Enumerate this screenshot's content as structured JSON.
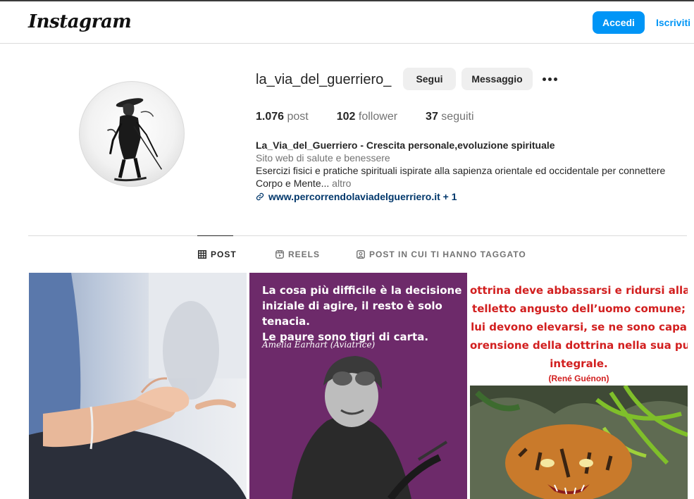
{
  "header": {
    "logo": "Instagram",
    "login_label": "Accedi",
    "signup_label": "Iscriviti"
  },
  "profile": {
    "username": "la_via_del_guerriero_",
    "follow_label": "Segui",
    "message_label": "Messaggio",
    "stats": {
      "posts_count": "1.076",
      "posts_label": "post",
      "followers_count": "102",
      "followers_label": "follower",
      "following_count": "37",
      "following_label": "seguiti"
    },
    "bio": {
      "name": "La_Via_del_Guerriero - Crescita personale,evoluzione spirituale",
      "category": "Sito web di salute e benessere",
      "text": "Esercizi fisici e pratiche spirituali ispirate alla sapienza orientale ed occidentale per connettere Corpo e Mente...",
      "more_label": "altro",
      "link": "www.percorrendolaviadelguerriero.it + 1"
    }
  },
  "tabs": [
    {
      "label": "POST",
      "icon": "grid-icon",
      "active": true
    },
    {
      "label": "REELS",
      "icon": "reels-icon",
      "active": false
    },
    {
      "label": "POST IN CUI TI HANNO TAGGATO",
      "icon": "tagged-icon",
      "active": false
    }
  ],
  "posts": [
    {
      "kind": "photo",
      "subject": "meditation hand mudra"
    },
    {
      "kind": "quote",
      "lines": [
        "La cosa più difficile è la decisione",
        "iniziale di agire, il resto è solo tenacia.",
        "Le paure sono tigri di carta."
      ],
      "author": "Amelia Earhart (Aviatrice)"
    },
    {
      "kind": "quote",
      "lines": [
        "ottrina deve abbassarsi e ridursi alla",
        "telletto angusto dell’uomo comune;",
        "lui devono elevarsi, se ne sono capa",
        "orensione della dottrina nella sua pu",
        "integrale."
      ],
      "author": "(René Guénon)"
    }
  ],
  "colors": {
    "accent": "#0095f6",
    "link": "#00376b",
    "muted": "#737373",
    "quote_purple": "#6d2a6a",
    "quote_red": "#d21f1f"
  }
}
